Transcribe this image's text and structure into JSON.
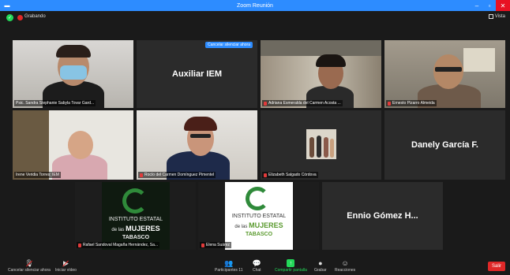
{
  "window": {
    "title": "Zoom Reunión",
    "minimize": "–",
    "maximize": "▫",
    "close": "✕"
  },
  "status": {
    "recording_label": "Grabando",
    "view_label": "Vista"
  },
  "recording_banner": "Cancelar silenciar ahora",
  "participants": [
    {
      "name": "Psic. Sandra Stephanie Sabyla Tovar Gard..."
    },
    {
      "name": "",
      "display": "Auxiliar IEM"
    },
    {
      "name": "Adriana Esmeralda del Carmen Acosta ..."
    },
    {
      "name": "Ernesto Pizarro Almeida"
    },
    {
      "name": "Irene Veridia Torres: IEM"
    },
    {
      "name": "Rocío del Carmen Domínguez Pimentel"
    },
    {
      "name": "Elizabeth Salgado Córdova"
    },
    {
      "name": "",
      "display": "Danely García F."
    },
    {
      "name": "Rafael Sandoval Magaña Hernández, Sa..."
    },
    {
      "name": "Elena Suárez"
    },
    {
      "name": "",
      "display": "Ennio Gómez H..."
    }
  ],
  "logo": {
    "line1": "INSTITUTO ESTATAL",
    "line2": "de las",
    "line3": "MUJERES",
    "line4": "TABASCO"
  },
  "toolbar": {
    "mute_label": "Cancelar silenciar ahora",
    "video_label": "Iniciar vídeo",
    "participants_label": "Participantes",
    "participants_count": "11",
    "chat_label": "Chat",
    "share_label": "Compartir pantalla",
    "record_label": "Grabar",
    "reactions_label": "Reacciones",
    "leave_label": "Salir"
  },
  "colors": {
    "accent": "#2d8cff",
    "active_speaker": "#c4d65b",
    "share_green": "#23d959",
    "leave_red": "#e02828"
  }
}
